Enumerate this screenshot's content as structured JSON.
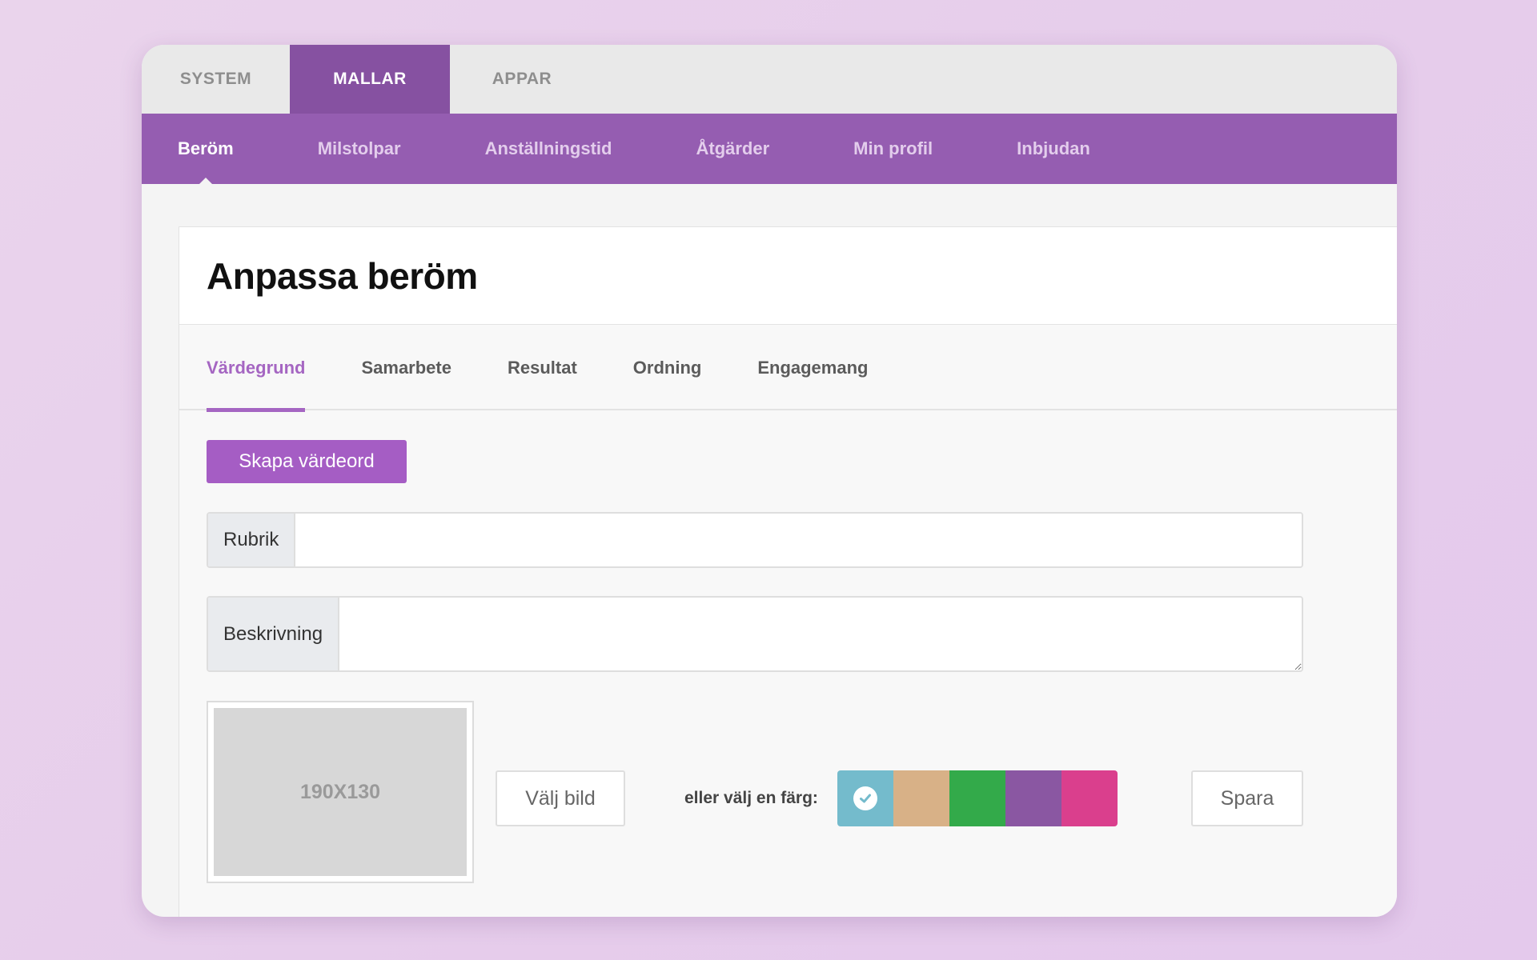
{
  "top_tabs": [
    {
      "label": "SYSTEM"
    },
    {
      "label": "MALLAR"
    },
    {
      "label": "APPAR"
    }
  ],
  "subnav": [
    {
      "label": "Beröm"
    },
    {
      "label": "Milstolpar"
    },
    {
      "label": "Anställningstid"
    },
    {
      "label": "Åtgärder"
    },
    {
      "label": "Min profil"
    },
    {
      "label": "Inbjudan"
    }
  ],
  "page": {
    "title": "Anpassa beröm"
  },
  "category_tabs": [
    {
      "label": "Värdegrund"
    },
    {
      "label": "Samarbete"
    },
    {
      "label": "Resultat"
    },
    {
      "label": "Ordning"
    },
    {
      "label": "Engagemang"
    }
  ],
  "form": {
    "create_label": "Skapa värdeord",
    "rubrik_label": "Rubrik",
    "rubrik_value": "",
    "beskrivning_label": "Beskrivning",
    "beskrivning_value": "",
    "image_placeholder": "190X130",
    "choose_image_label": "Välj bild",
    "color_label": "eller välj en färg:",
    "save_label": "Spara"
  },
  "colors": {
    "swatches": [
      "#74bbcc",
      "#d8b187",
      "#33aa4a",
      "#8a57a2",
      "#da3f8d"
    ],
    "selected_index": 0,
    "check_color": "#74bbcc"
  }
}
